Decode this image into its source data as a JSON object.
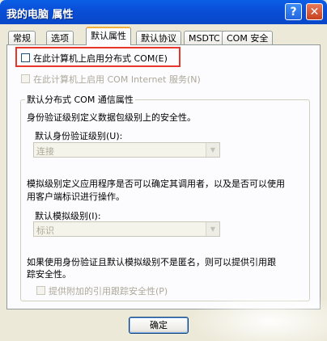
{
  "window": {
    "title": "我的电脑 属性"
  },
  "titlebar": {
    "help_glyph": "?",
    "close_glyph": "✕"
  },
  "tabs": [
    {
      "label": "常规"
    },
    {
      "label": "选项"
    },
    {
      "label": "默认属性"
    },
    {
      "label": "默认协议"
    },
    {
      "label": "MSDTC"
    },
    {
      "label": "COM 安全"
    }
  ],
  "options": {
    "enable_dcom": {
      "label": "在此计算机上启用分布式 COM(E)",
      "checked": false
    },
    "enable_internet": {
      "label": "在此计算机上启用 COM Internet 服务(N)",
      "checked": false
    }
  },
  "group": {
    "title": "默认分布式 COM 通信属性",
    "auth_desc": "身份验证级别定义数据包级别上的安全性。",
    "auth_label": "默认身份验证级别(U):",
    "auth_value": "连接",
    "imp_desc_1": "模拟级别定义应用程序是否可以确定其调用者，以及是否可以使用",
    "imp_desc_2": "用客户端标识进行操作。",
    "imp_label": "默认模拟级别(I):",
    "imp_value": "标识",
    "ref_desc_1": "如果使用身份验证且默认模拟级别不是匿名，则可以提供引用跟",
    "ref_desc_2": "踪安全性。",
    "ref_check_label": "提供附加的引用跟踪安全性(P)"
  },
  "buttons": {
    "ok": "确定"
  },
  "colors": {
    "highlight": "#E8352A",
    "titlebar": "#0A4FD8"
  }
}
